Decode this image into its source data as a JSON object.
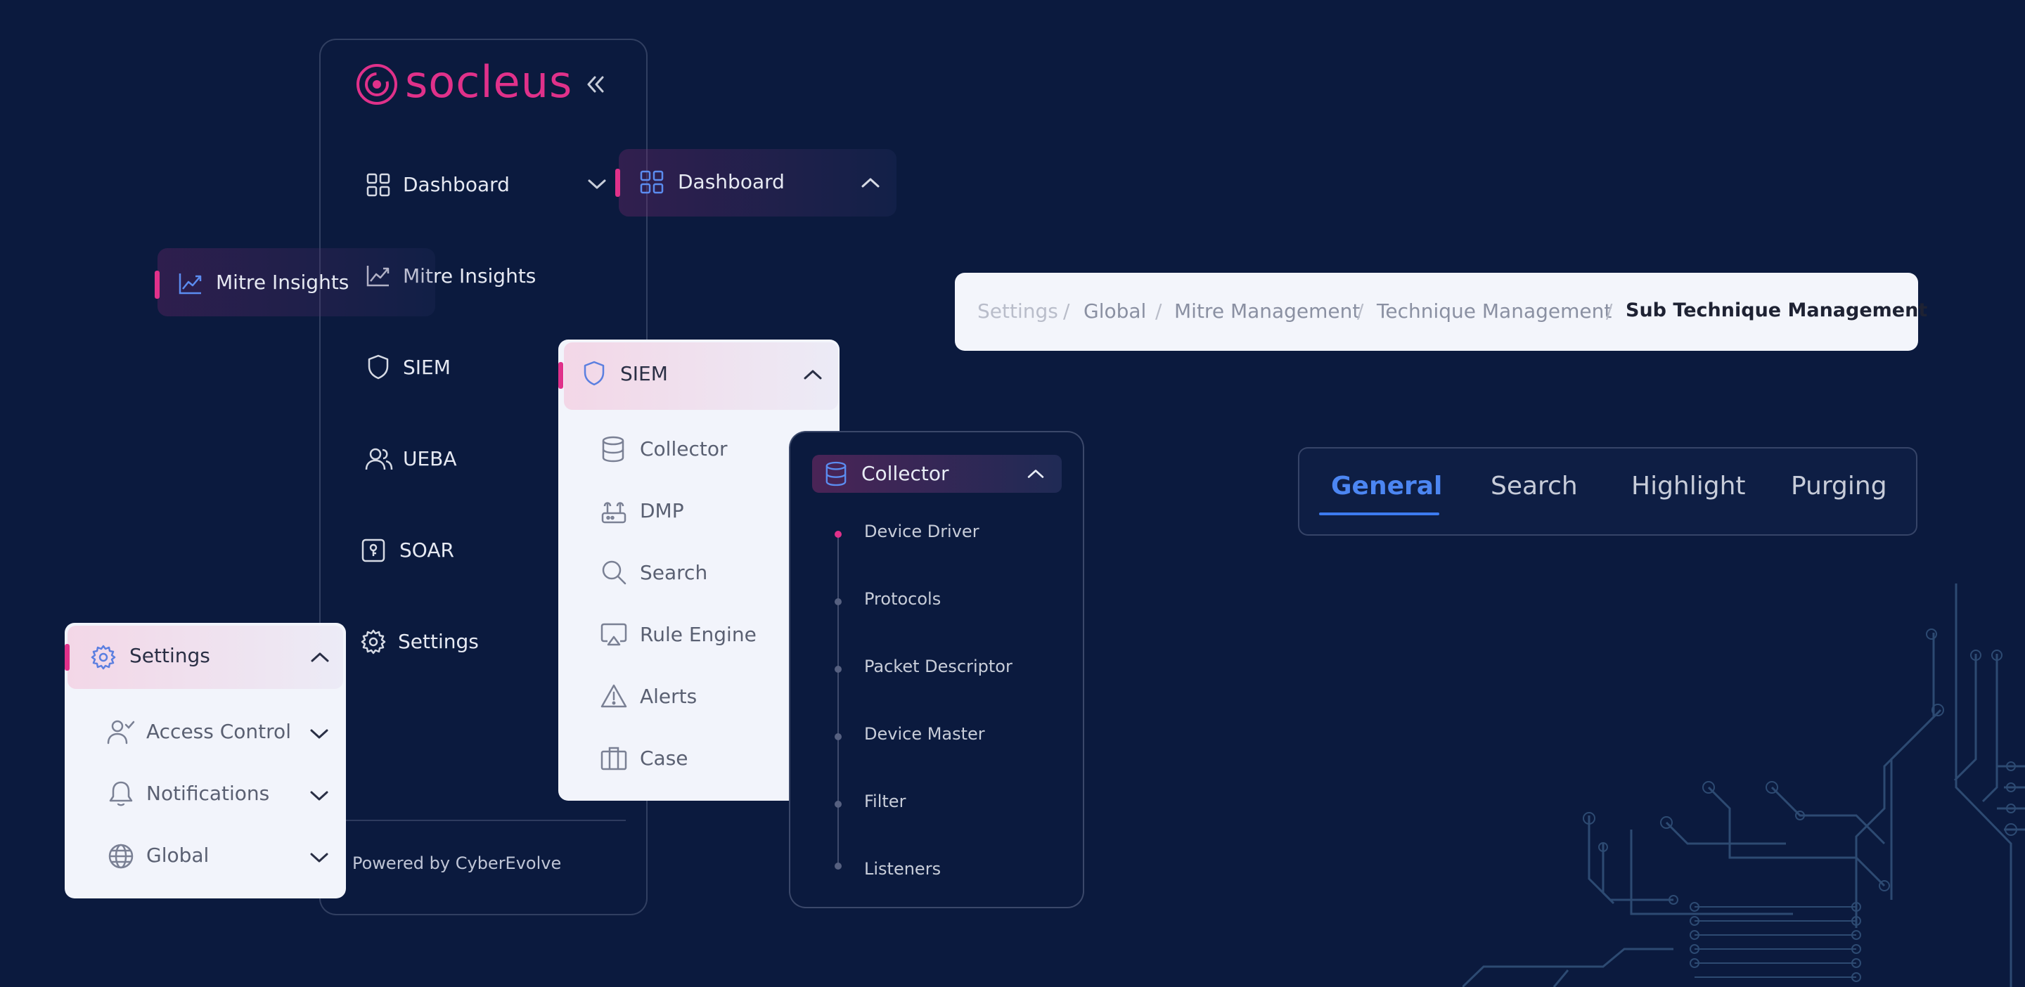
{
  "brand": {
    "logo_text": "socleus",
    "color": "#e0318a"
  },
  "sidebar": {
    "collapse_icon": "double-chevron-left-icon",
    "items": [
      {
        "label": "Dashboard",
        "icon": "grid-icon"
      },
      {
        "label": "Mitre Insights",
        "icon": "chart-line-icon"
      },
      {
        "label": "SIEM",
        "icon": "shield-icon"
      },
      {
        "label": "UEBA",
        "icon": "users-icon"
      },
      {
        "label": "SOAR",
        "icon": "lock-box-icon"
      },
      {
        "label": "Settings",
        "icon": "gear-icon"
      }
    ],
    "footer": "Powered by CyberEvolve"
  },
  "dashboard_popup": {
    "label": "Dashboard"
  },
  "mitre_popup": {
    "label": "Mitre Insights"
  },
  "siem_panel": {
    "title": "SIEM",
    "items": [
      {
        "label": "Collector",
        "icon": "database-icon"
      },
      {
        "label": "DMP",
        "icon": "router-icon"
      },
      {
        "label": "Search",
        "icon": "search-icon"
      },
      {
        "label": "Rule Engine",
        "icon": "monitor-icon"
      },
      {
        "label": "Alerts",
        "icon": "warning-icon"
      },
      {
        "label": "Case",
        "icon": "briefcase-icon"
      }
    ]
  },
  "collector_panel": {
    "title": "Collector",
    "items": [
      "Device Driver",
      "Protocols",
      "Packet Descriptor",
      "Device Master",
      "Filter",
      "Listeners"
    ],
    "active_index": 0
  },
  "settings_panel": {
    "title": "Settings",
    "items": [
      {
        "label": "Access Control",
        "icon": "user-check-icon"
      },
      {
        "label": "Notifications",
        "icon": "bell-icon"
      },
      {
        "label": "Global",
        "icon": "globe-icon"
      }
    ]
  },
  "breadcrumb": [
    "Settings",
    "Global",
    "Mitre Management",
    "Technique Management",
    "Sub Technique Management"
  ],
  "breadcrumb_separator": "/",
  "tabs": {
    "items": [
      "General",
      "Search",
      "Highlight",
      "Purging"
    ],
    "active_index": 0
  },
  "colors": {
    "background": "#0b1a3e",
    "accent_pink": "#e0318a",
    "accent_blue": "#3d7bf0"
  }
}
